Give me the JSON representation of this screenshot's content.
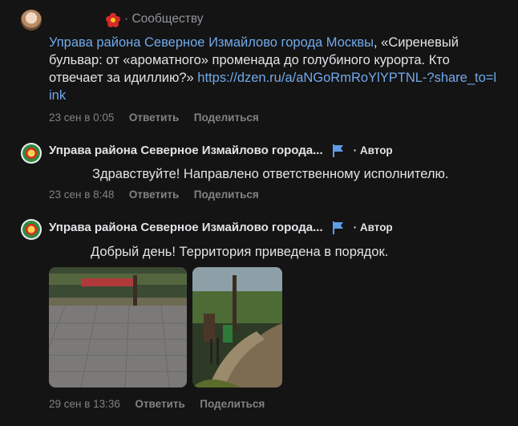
{
  "post": {
    "community_label": "Сообществу",
    "separator": "·",
    "text_link": "Управа района Северное Измайлово города Москвы",
    "text_body": ", «Сиреневый бульвар: от «ароматного» променада до голубиного курорта. Кто отвечает за идиллию?» ",
    "url": "https://dzen.ru/a/aNGoRmRoYlYPTNL-?share_to=link",
    "date": "23 сен в 0:05",
    "reply_label": "Ответить",
    "share_label": "Поделиться"
  },
  "replies": [
    {
      "author": "Управа района Северное Измайлово города...",
      "badge": "· Автор",
      "text": "Здравствуйте! Направлено ответственному исполнителю.",
      "date": "23 сен в 8:48",
      "reply_label": "Ответить",
      "share_label": "Поделиться"
    },
    {
      "author": "Управа района Северное Измайлово города...",
      "badge": "· Автор",
      "text": "Добрый день! Территория приведена в порядок.",
      "date": "29 сен в 13:36",
      "reply_label": "Ответить",
      "share_label": "Поделиться"
    }
  ],
  "colors": {
    "background": "#141414",
    "link": "#71aaeb",
    "muted": "#828282",
    "flag": "#5e9ce8"
  },
  "icons": [
    "flower-icon",
    "flag-icon"
  ]
}
